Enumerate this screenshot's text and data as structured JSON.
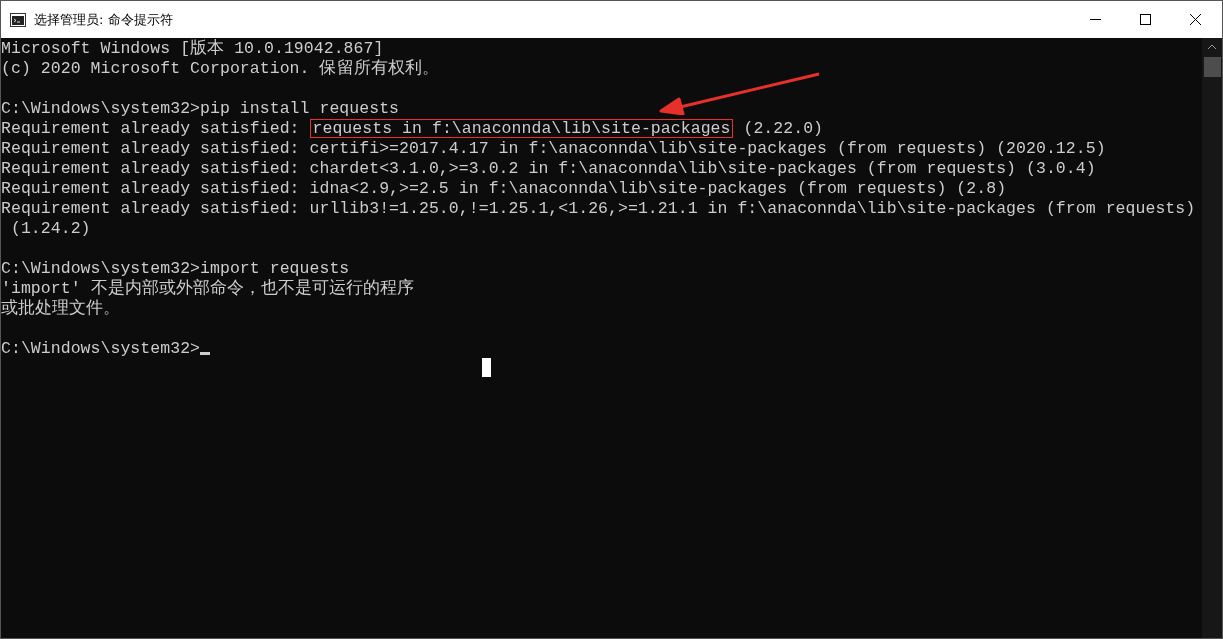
{
  "window": {
    "title": "选择管理员: 命令提示符"
  },
  "console": {
    "lines": [
      {
        "kind": "plain",
        "text": "Microsoft Windows [版本 10.0.19042.867]"
      },
      {
        "kind": "plain",
        "text": "(c) 2020 Microsoft Corporation. 保留所有权利。"
      },
      {
        "kind": "blank"
      },
      {
        "kind": "plain",
        "text": "C:\\Windows\\system32>pip install requests"
      },
      {
        "kind": "highlighted",
        "prefix": "Requirement already satisfied:",
        "highlighted": "requests in f:\\anaconnda\\lib\\site-packages",
        "suffix": "(2.22.0)"
      },
      {
        "kind": "plain",
        "text": "Requirement already satisfied: certifi>=2017.4.17 in f:\\anaconnda\\lib\\site-packages (from requests) (2020.12.5)"
      },
      {
        "kind": "plain",
        "text": "Requirement already satisfied: chardet<3.1.0,>=3.0.2 in f:\\anaconnda\\lib\\site-packages (from requests) (3.0.4)"
      },
      {
        "kind": "plain",
        "text": "Requirement already satisfied: idna<2.9,>=2.5 in f:\\anaconnda\\lib\\site-packages (from requests) (2.8)"
      },
      {
        "kind": "plain",
        "text": "Requirement already satisfied: urllib3!=1.25.0,!=1.25.1,<1.26,>=1.21.1 in f:\\anaconnda\\lib\\site-packages (from requests)"
      },
      {
        "kind": "plain",
        "text": " (1.24.2)"
      },
      {
        "kind": "blank"
      },
      {
        "kind": "plain",
        "text": "C:\\Windows\\system32>import requests"
      },
      {
        "kind": "plain",
        "text": "'import' 不是内部或外部命令，也不是可运行的程序"
      },
      {
        "kind": "plain",
        "text": "或批处理文件。"
      },
      {
        "kind": "blank"
      },
      {
        "kind": "prompt",
        "text": "C:\\Windows\\system32>"
      }
    ]
  }
}
